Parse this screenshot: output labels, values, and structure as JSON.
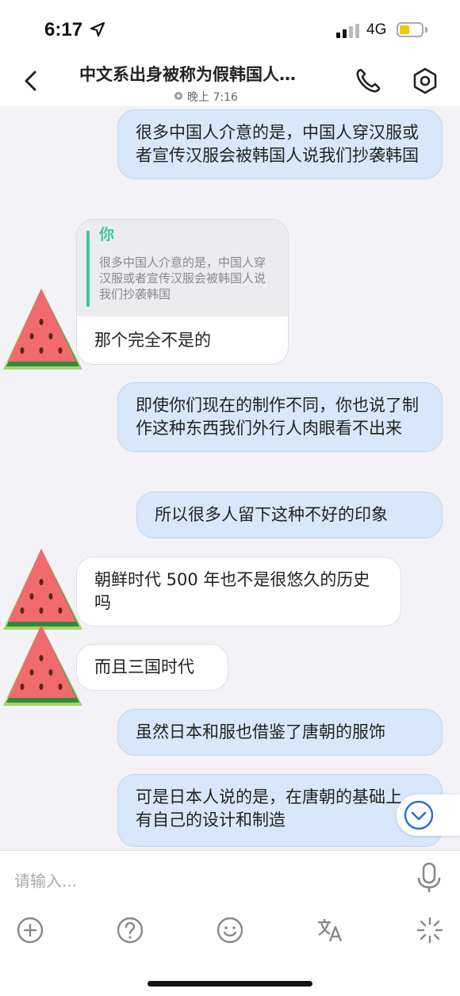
{
  "status_bar": {
    "time": "6:17",
    "network": "4G"
  },
  "header": {
    "title": "中文系出身被称为假韩国人…",
    "subtitle": "晚上 7:16"
  },
  "messages": [
    {
      "side": "right",
      "text": "很多中国人介意的是，中国人穿汉服或者宣传汉服会被韩国人说我们抄袭韩国"
    },
    {
      "side": "left",
      "quote_name": "你",
      "quote_text": "很多中国人介意的是，中国人穿汉服或者宣传汉服会被韩国人说我们抄袭韩国",
      "text": "那个完全不是的"
    },
    {
      "side": "right",
      "text": "即使你们现在的制作不同，你也说了制作这种东西我们外行人肉眼看不出来"
    },
    {
      "side": "right",
      "text": "所以很多人留下这种不好的印象"
    },
    {
      "side": "left",
      "text": "朝鲜时代 500 年也不是很悠久的历史吗"
    },
    {
      "side": "left",
      "text": "而且三国时代"
    },
    {
      "side": "right",
      "text": "虽然日本和服也借鉴了唐朝的服饰"
    },
    {
      "side": "right",
      "text": "可是日本人说的是，在唐朝的基础上，有自己的设计和制造"
    }
  ],
  "composer": {
    "placeholder": "请输入..."
  },
  "icons": {
    "back": "chevron-left-icon",
    "call": "phone-icon",
    "settings": "gear-hexagon-icon",
    "avatar": "watermelon-slice-icon",
    "scroll_down": "chevron-down-circle-icon",
    "mic": "microphone-icon",
    "tools": [
      "plus-circle-icon",
      "question-circle-icon",
      "smiley-icon",
      "translate-icon",
      "sparkle-icon"
    ]
  },
  "colors": {
    "outgoing_bubble": "#d8e8fa",
    "quote_accent": "#3cc6a0",
    "background": "#f2f2f7"
  }
}
